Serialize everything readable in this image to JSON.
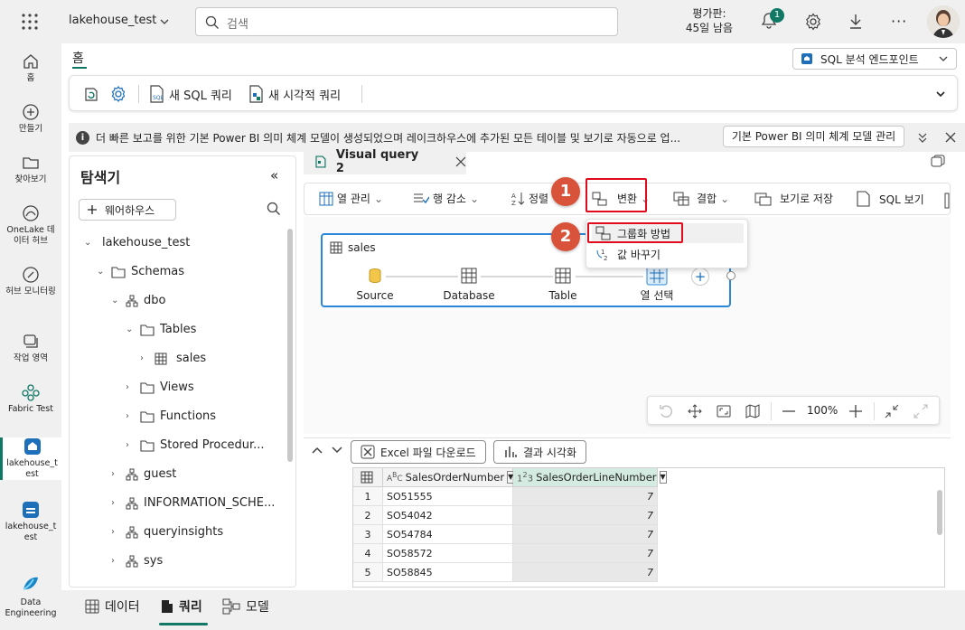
{
  "topbar": {
    "workspace": "lakehouse_test",
    "search_placeholder": "검색",
    "trial_line1": "평가판:",
    "trial_line2": "45일 남음",
    "notification_count": "1"
  },
  "leftnav": {
    "items": [
      {
        "label": "홈"
      },
      {
        "label": "만들기"
      },
      {
        "label": "찾아보기"
      },
      {
        "label": "OneLake 데이터 허브"
      },
      {
        "label": "허브 모니터링"
      },
      {
        "label": "작업 영역"
      },
      {
        "label": "Fabric Test"
      },
      {
        "label": "lakehouse_test"
      },
      {
        "label": "lakehouse_test"
      },
      {
        "label": "Data Engineering"
      }
    ]
  },
  "home": {
    "tab": "홈",
    "endpoint_select": "SQL 분석 엔드포인트"
  },
  "ribbon": {
    "new_sql": "새 SQL 쿼리",
    "new_visual": "새 시각적 쿼리"
  },
  "infobar": {
    "text": "더 빠른 보고를 위한 기본 Power BI 의미 체계 모델이 생성되었으며 레이크하우스에 추가된 모든 테이블 및 보기로 자동으로 업...",
    "button": "기본 Power BI 의미 체계 모델 관리"
  },
  "explorer": {
    "title": "탐색기",
    "add_warehouse": "웨어하우스",
    "tree": [
      {
        "label": "lakehouse_test"
      },
      {
        "label": "Schemas"
      },
      {
        "label": "dbo"
      },
      {
        "label": "Tables"
      },
      {
        "label": "sales"
      },
      {
        "label": "Views"
      },
      {
        "label": "Functions"
      },
      {
        "label": "Stored Procedur..."
      },
      {
        "label": "guest"
      },
      {
        "label": "INFORMATION_SCHE..."
      },
      {
        "label": "queryinsights"
      },
      {
        "label": "sys"
      }
    ]
  },
  "query": {
    "tab": "Visual query 2",
    "toolbar": {
      "manage_cols": "열 관리",
      "reduce_rows": "행 감소",
      "sort": "정렬",
      "transform": "변환",
      "combine": "결합",
      "save_view": "보기로 저장",
      "sql_view": "SQL 보기"
    },
    "dropdown": {
      "group_by": "그룹화 방법",
      "replace": "값 바꾸기"
    },
    "badges": [
      "1",
      "2"
    ],
    "node": {
      "title": "sales",
      "steps": [
        "Source",
        "Database",
        "Table",
        "열 선택"
      ]
    },
    "zoom": "100%"
  },
  "results": {
    "excel_btn": "Excel 파일 다운로드",
    "visualize_btn": "결과 시각화",
    "columns": [
      "SalesOrderNumber",
      "SalesOrderLineNumber"
    ],
    "rows": [
      {
        "n": "1",
        "order": "SO51555",
        "line": "7"
      },
      {
        "n": "2",
        "order": "SO54042",
        "line": "7"
      },
      {
        "n": "3",
        "order": "SO54784",
        "line": "7"
      },
      {
        "n": "4",
        "order": "SO58572",
        "line": "7"
      },
      {
        "n": "5",
        "order": "SO58845",
        "line": "7"
      }
    ]
  },
  "bottomtabs": {
    "data": "데이터",
    "query": "쿼리",
    "model": "모델"
  },
  "colors": {
    "accent": "#117865",
    "highlight_red": "#e00b1c",
    "badge": "#d9533b",
    "node_border": "#2b88d8"
  }
}
